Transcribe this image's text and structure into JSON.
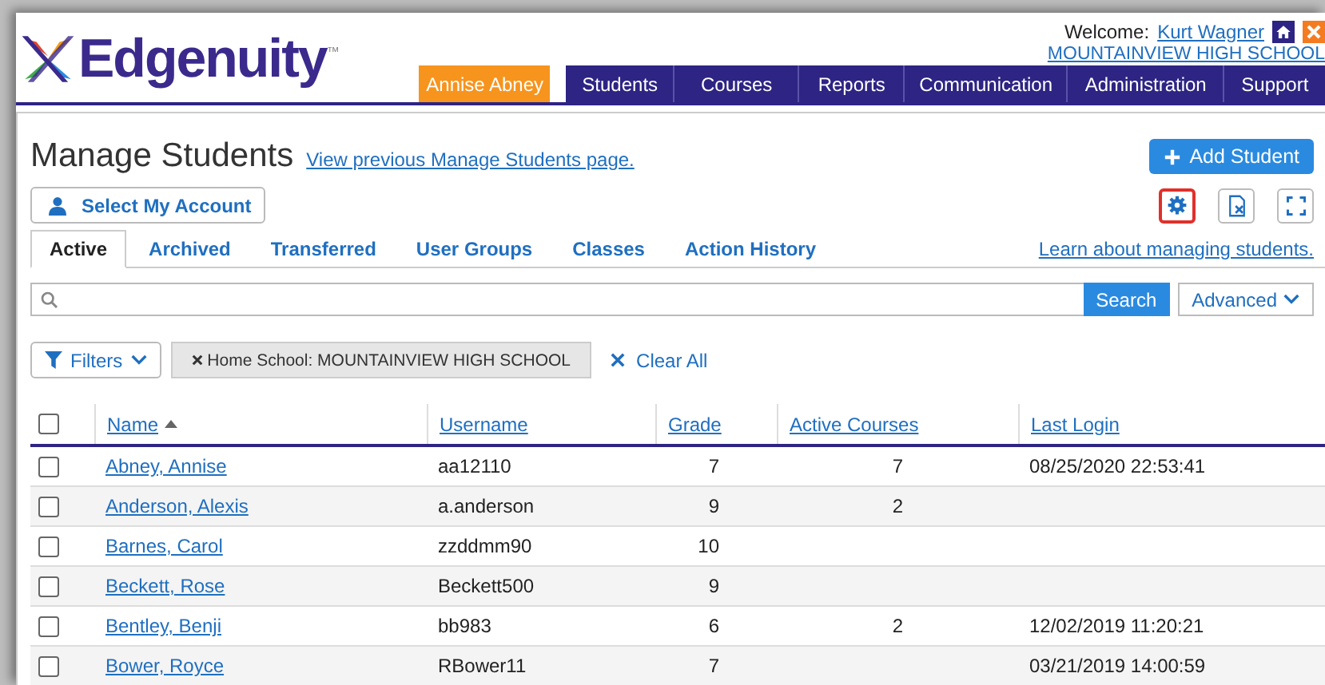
{
  "header": {
    "logo": "Edgenuity",
    "trademark": "™",
    "welcome_label": "Welcome:",
    "user_link": "Kurt Wagner",
    "school_link": "MOUNTAINVIEW HIGH SCHOOL",
    "nav_tabs": [
      {
        "label": "Annise Abney",
        "selected": true
      },
      {
        "label": "Students",
        "selected": false
      },
      {
        "label": "Courses",
        "selected": false
      },
      {
        "label": "Reports",
        "selected": false
      },
      {
        "label": "Communication",
        "selected": false
      },
      {
        "label": "Administration",
        "selected": false
      },
      {
        "label": "Support",
        "selected": false
      }
    ]
  },
  "page": {
    "title": "Manage Students",
    "previous_link": "View previous Manage Students page.",
    "add_button": "Add Student",
    "account_button": "Select My Account",
    "tabs": [
      {
        "label": "Active",
        "selected": true
      },
      {
        "label": "Archived",
        "selected": false
      },
      {
        "label": "Transferred",
        "selected": false
      },
      {
        "label": "User Groups",
        "selected": false
      },
      {
        "label": "Classes",
        "selected": false
      },
      {
        "label": "Action History",
        "selected": false
      }
    ],
    "help_link": "Learn about managing students.",
    "search_button": "Search",
    "advanced_button": "Advanced",
    "filters_button": "Filters",
    "filter_chip": "Home School: MOUNTAINVIEW HIGH SCHOOL",
    "clear_all": "Clear All"
  },
  "table": {
    "select_all": {
      "checked": false
    },
    "columns": [
      {
        "label": "Name",
        "sorted": true
      },
      {
        "label": "Username",
        "sorted": false
      },
      {
        "label": "Grade",
        "sorted": false
      },
      {
        "label": "Active Courses",
        "sorted": false
      },
      {
        "label": "Last Login",
        "sorted": false
      }
    ],
    "rows": [
      {
        "checked": false,
        "name": "Abney, Annise",
        "username": "aa12110",
        "grade": "7",
        "active_courses": "7",
        "last_login": "08/25/2020 22:53:41"
      },
      {
        "checked": false,
        "name": "Anderson, Alexis",
        "username": "a.anderson",
        "grade": "9",
        "active_courses": "2"
      },
      {
        "checked": false,
        "name": "Barnes, Carol",
        "username": "zzddmm90",
        "grade": "10"
      },
      {
        "checked": false,
        "name": "Beckett, Rose",
        "username": "Beckett500",
        "grade": "9"
      },
      {
        "checked": false,
        "name": "Bentley, Benji",
        "username": "bb983",
        "grade": "6",
        "active_courses": "2",
        "last_login": "12/02/2019 11:20:21"
      },
      {
        "checked": false,
        "name": "Bower, Royce",
        "username": "RBower11",
        "grade": "7",
        "last_login": "03/21/2019 14:00:59"
      }
    ]
  }
}
